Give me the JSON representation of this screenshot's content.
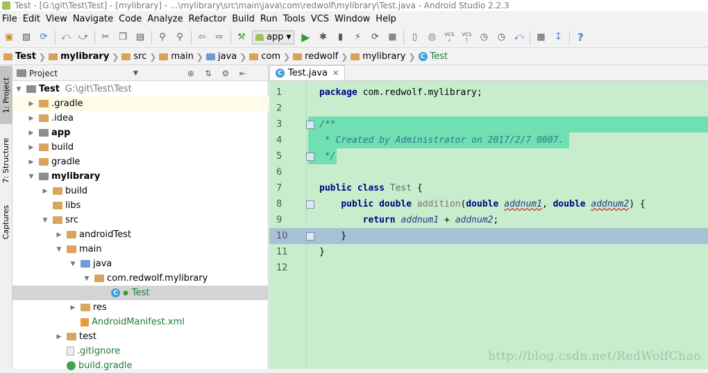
{
  "window": {
    "title": "Test - [G:\\git\\Test\\Test] - [mylibrary] - ...\\mylibrary\\src\\main\\java\\com\\redwolf\\mylibrary\\Test.java - Android Studio 2.2.3"
  },
  "menu": [
    "File",
    "Edit",
    "View",
    "Navigate",
    "Code",
    "Analyze",
    "Refactor",
    "Build",
    "Run",
    "Tools",
    "VCS",
    "Window",
    "Help"
  ],
  "toolbar": {
    "run_config": "app",
    "vcs_label": "VCS",
    "help": "?"
  },
  "breadcrumb": [
    {
      "label": "Test",
      "bold": true
    },
    {
      "label": "mylibrary",
      "bold": true
    },
    {
      "label": "src"
    },
    {
      "label": "main"
    },
    {
      "label": "java"
    },
    {
      "label": "com"
    },
    {
      "label": "redwolf"
    },
    {
      "label": "mylibrary"
    },
    {
      "label": "Test"
    }
  ],
  "side_tabs": [
    "1: Project",
    "7: Structure",
    "Captures"
  ],
  "project_panel": {
    "title": "Project",
    "tree": [
      {
        "label": "Test",
        "path": "G:\\git\\Test\\Test"
      },
      {
        "label": ".gradle"
      },
      {
        "label": ".idea"
      },
      {
        "label": "app"
      },
      {
        "label": "build"
      },
      {
        "label": "gradle"
      },
      {
        "label": "mylibrary"
      },
      {
        "label": "build"
      },
      {
        "label": "libs"
      },
      {
        "label": "src"
      },
      {
        "label": "androidTest"
      },
      {
        "label": "main"
      },
      {
        "label": "java"
      },
      {
        "label": "com.redwolf.mylibrary"
      },
      {
        "label": "Test"
      },
      {
        "label": "res"
      },
      {
        "label": "AndroidManifest.xml"
      },
      {
        "label": "test"
      },
      {
        "label": ".gitignore"
      },
      {
        "label": "build.gradle"
      }
    ]
  },
  "editor": {
    "tab": "Test.java",
    "lines": [
      {
        "n": "1",
        "text": "package com.redwolf.mylibrary;"
      },
      {
        "n": "2",
        "text": ""
      },
      {
        "n": "3",
        "text": "/**"
      },
      {
        "n": "4",
        "text": " * Created by Administrator on 2017/2/7 0007."
      },
      {
        "n": "5",
        "text": " */"
      },
      {
        "n": "6",
        "text": ""
      },
      {
        "n": "7",
        "text": "public class Test {"
      },
      {
        "n": "8",
        "text": "    public double addition(double addnum1, double addnum2) {"
      },
      {
        "n": "9",
        "text": "        return addnum1 + addnum2;"
      },
      {
        "n": "10",
        "text": "    }"
      },
      {
        "n": "11",
        "text": "}"
      },
      {
        "n": "12",
        "text": ""
      }
    ]
  },
  "watermark": "http://blog.csdn.net/RedWolfChao"
}
